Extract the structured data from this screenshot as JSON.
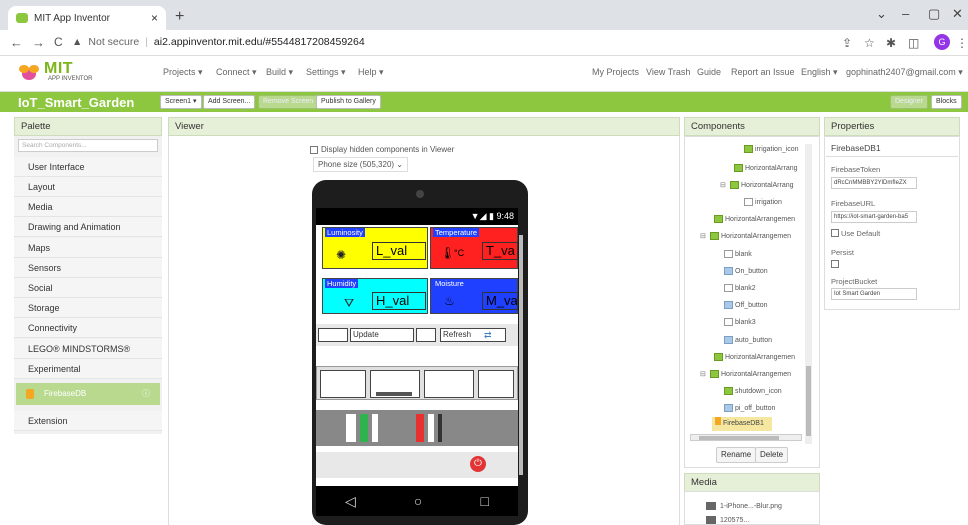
{
  "browser": {
    "tab_title": "MIT App Inventor",
    "tab_close": "×",
    "new_tab": "+",
    "url_warning": "Not secure",
    "url": "ai2.appinventor.mit.edu/#5544817208459264",
    "profile_initial": "G",
    "back": "←",
    "forward": "→",
    "reload": "C"
  },
  "app_header": {
    "logo_main": "MIT",
    "logo_sub": "APP INVENTOR",
    "menus": [
      "Projects ▾",
      "Connect ▾",
      "Build ▾",
      "Settings ▾",
      "Help ▾"
    ],
    "right_links": [
      "My Projects",
      "View Trash",
      "Guide",
      "Report an Issue",
      "English ▾",
      "gophinath2407@gmail.com ▾"
    ]
  },
  "project_bar": {
    "name": "IoT_Smart_Garden",
    "screen_select": "Screen1 ▾",
    "add_screen": "Add Screen...",
    "remove_screen": "Remove Screen",
    "publish": "Publish to Gallery",
    "designer": "Designer",
    "blocks": "Blocks"
  },
  "palette": {
    "title": "Palette",
    "search_placeholder": "Search Components...",
    "categories": [
      "User Interface",
      "Layout",
      "Media",
      "Drawing and Animation",
      "Maps",
      "Sensors",
      "Social",
      "Storage",
      "Connectivity",
      "LEGO® MINDSTORMS®",
      "Experimental"
    ],
    "selected_item": "FirebaseDB",
    "extension": "Extension"
  },
  "viewer": {
    "title": "Viewer",
    "display_hidden": "Display hidden components in Viewer",
    "phone_size": "Phone size (505,320)",
    "status_time": "9:48",
    "luminosity": "Luminosity",
    "temperature": "Temperature",
    "humidity": "Humidity",
    "moisture": "Moisture",
    "l_val": "L_val",
    "t_val": "T_va",
    "h_val": "H_val",
    "m_val": "M_va",
    "temp_unit": "°C",
    "update": "Update",
    "refresh": "Refresh",
    "nav_back": "◁",
    "nav_home": "○",
    "nav_recent": "□",
    "colors": {
      "luminosity": "#ffff00",
      "temperature": "#ff2020",
      "humidity": "#00ffff",
      "moisture": "#2040ff"
    }
  },
  "components": {
    "title": "Components",
    "items": [
      {
        "label": "irrigation_icon",
        "type": "img",
        "toggle": ""
      },
      {
        "label": "HorizontalArrang",
        "type": "hz",
        "toggle": ""
      },
      {
        "label": "HorizontalArrang",
        "type": "hz",
        "toggle": "⊟"
      },
      {
        "label": "irrigation",
        "type": "lbl",
        "toggle": ""
      },
      {
        "label": "HorizontalArrangemen",
        "type": "hz",
        "toggle": ""
      },
      {
        "label": "HorizontalArrangemen",
        "type": "hz",
        "toggle": "⊟"
      },
      {
        "label": "blank",
        "type": "lbl",
        "toggle": ""
      },
      {
        "label": "On_button",
        "type": "btn",
        "toggle": ""
      },
      {
        "label": "blank2",
        "type": "lbl",
        "toggle": ""
      },
      {
        "label": "Off_button",
        "type": "btn",
        "toggle": ""
      },
      {
        "label": "blank3",
        "type": "lbl",
        "toggle": ""
      },
      {
        "label": "auto_button",
        "type": "btn",
        "toggle": ""
      },
      {
        "label": "HorizontalArrangemen",
        "type": "hz",
        "toggle": ""
      },
      {
        "label": "HorizontalArrangemen",
        "type": "hz",
        "toggle": "⊟"
      },
      {
        "label": "shutdown_icon",
        "type": "img",
        "toggle": ""
      },
      {
        "label": "pi_off_button",
        "type": "btn",
        "toggle": ""
      }
    ],
    "selected": "FirebaseDB1",
    "rename": "Rename",
    "delete": "Delete"
  },
  "media": {
    "title": "Media",
    "items": [
      "1-iPhone...-Blur.png",
      "120575..."
    ]
  },
  "properties": {
    "title": "Properties",
    "component": "FirebaseDB1",
    "firebase_token_label": "FirebaseToken",
    "firebase_token": "dRcCnMMBBY2YlDmfIeZX",
    "firebase_url_label": "FirebaseURL",
    "firebase_url": "https://iot-smart-garden-ba5",
    "use_default": "Use Default",
    "persist_label": "Persist",
    "project_bucket_label": "ProjectBucket",
    "project_bucket": "Iot Smart Garden"
  }
}
